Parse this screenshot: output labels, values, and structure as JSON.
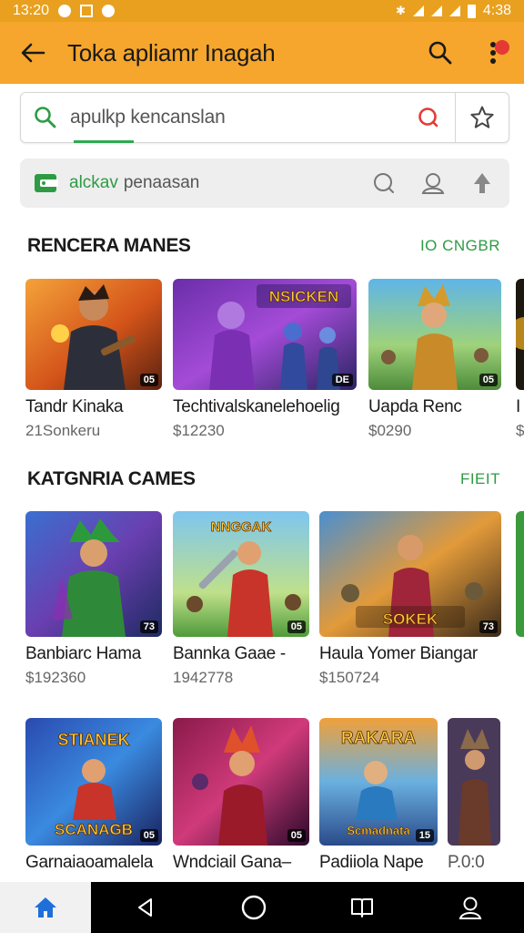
{
  "status_bar": {
    "time": "13:20",
    "clock": "4:38"
  },
  "app_bar": {
    "title": "Toka apliamr Inagah"
  },
  "search": {
    "text": "apulkp kencanslan"
  },
  "filter": {
    "accent": "alckav",
    "text": "penaasan"
  },
  "sections": [
    {
      "title": "RENCERA MANES",
      "link": "IO CNGBR",
      "cards": [
        {
          "name": "Tandr Kinaka",
          "price": "21Sonkeru",
          "badge": "05"
        },
        {
          "name": "Techtivalskanelehoelig",
          "price": "$12230",
          "badge": "DE",
          "art_text": "NSICKEN"
        },
        {
          "name": "Uapda Renc",
          "price": "$0290",
          "badge": "05"
        },
        {
          "name": "I",
          "price": "$"
        }
      ]
    },
    {
      "title": "KATGNRIA CAMES",
      "link": "FIEIT",
      "cards": [
        {
          "name": "Banbiarc Hama",
          "price": "$192360",
          "badge": "73"
        },
        {
          "name": "Bannka Gaae -",
          "price": "1942778",
          "badge": "05",
          "art_text": "NNGGAK"
        },
        {
          "name": "Haula Yomer Biangar",
          "price": "$150724",
          "badge": "73",
          "art_text": "SOKEK"
        }
      ]
    },
    {
      "cards": [
        {
          "name": "Garnaiaoamalela",
          "price": "",
          "badge": "05",
          "art_text": "SCANAGB",
          "art_text_top": "STIANEK"
        },
        {
          "name": "Wndciail Gana–",
          "price": "",
          "badge": "05"
        },
        {
          "name": "Padiiola Nape",
          "price": "",
          "badge": "15",
          "art_text": "Scmadnata",
          "art_text_top": "RAKARA"
        },
        {
          "name": "P.0:0",
          "price": ""
        }
      ]
    }
  ],
  "colors": {
    "app_bar": "#f6a62c",
    "status_bar": "#e8a01e",
    "accent_green": "#2e9b44",
    "nav_bg": "#000000"
  }
}
